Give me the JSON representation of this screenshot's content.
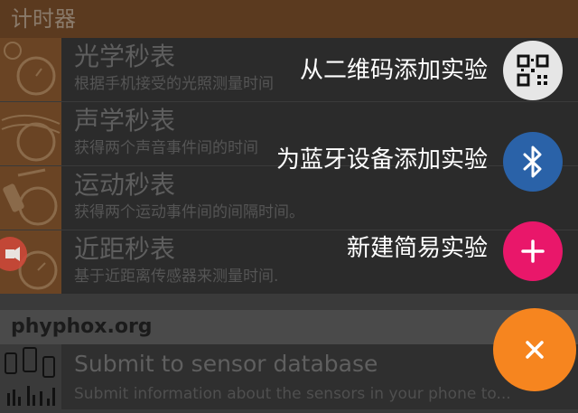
{
  "header": {
    "title": "计时器"
  },
  "experiments": [
    {
      "name": "光学秒表",
      "description": "根据手机接受的光照测量时间"
    },
    {
      "name": "声学秒表",
      "description": "获得两个声音事件间的时间"
    },
    {
      "name": "运动秒表",
      "description": "获得两个运动事件间的间隔时间。"
    },
    {
      "name": "近距秒表",
      "description": "基于近距离传感器来测量时间."
    }
  ],
  "section": {
    "label": "phyphox.org"
  },
  "submit": {
    "name": "Submit to sensor database",
    "description": "Submit information about the sensors in your phone to..."
  },
  "fab_menu": {
    "qr_label": "从二维码添加实验",
    "bluetooth_label": "为蓝牙设备添加实验",
    "simple_label": "新建简易实验"
  },
  "colors": {
    "header_bg": "#5b3a1f",
    "bluetooth_fab": "#2a62a8",
    "simple_fab": "#e9176a",
    "main_fab": "#f6851f",
    "qr_fab": "#e6e6e6"
  },
  "icons": {
    "qr": "qr-code-icon",
    "bluetooth": "bluetooth-icon",
    "add": "plus-icon",
    "close": "close-icon"
  }
}
